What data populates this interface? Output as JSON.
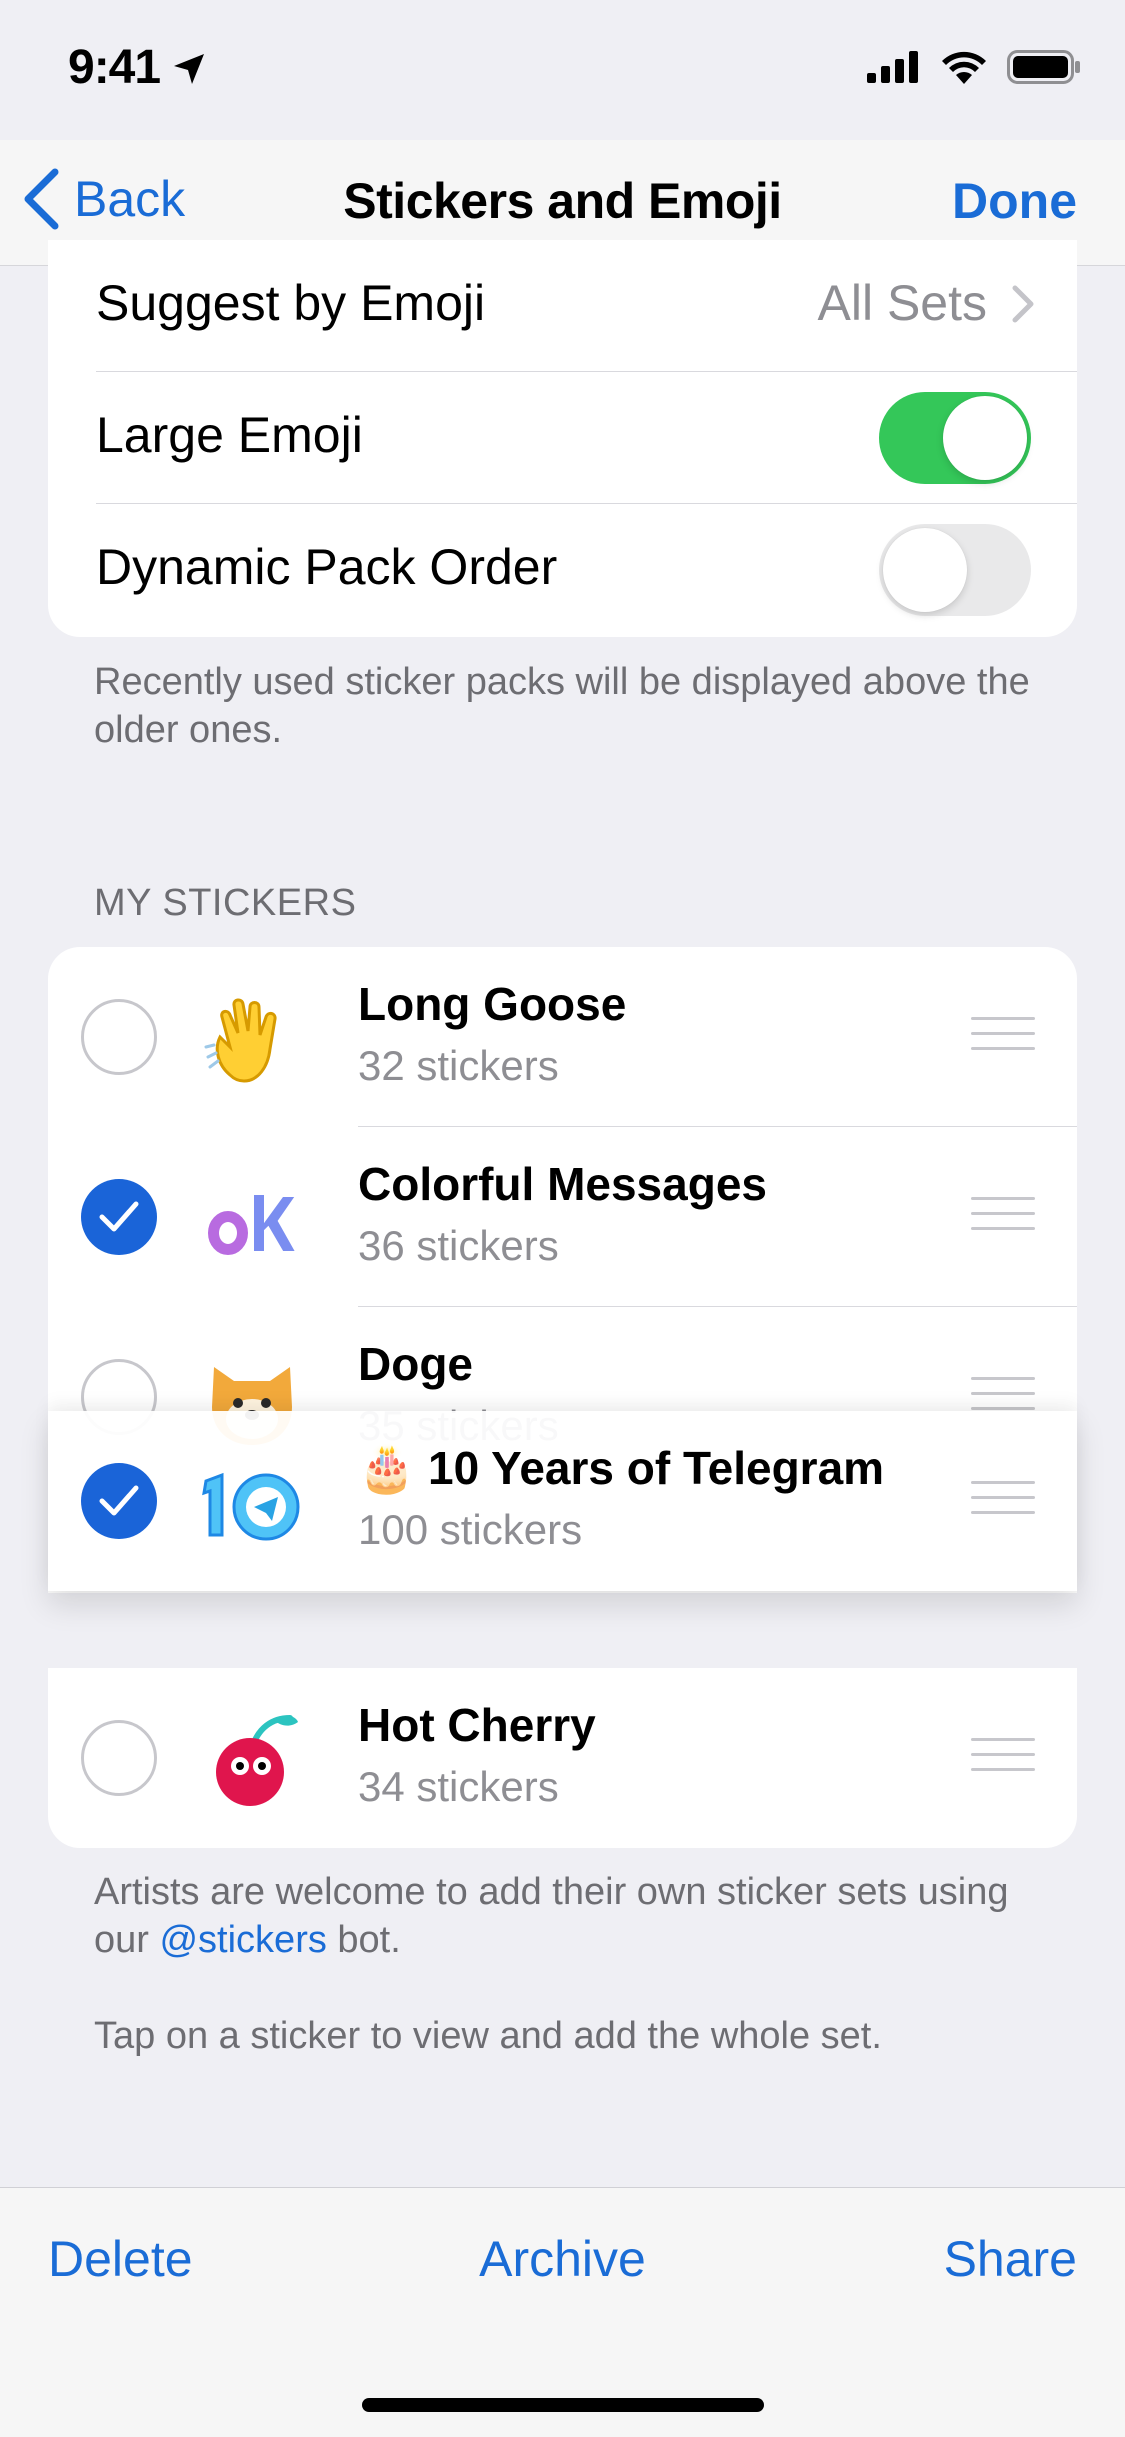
{
  "status_bar": {
    "time": "9:41"
  },
  "nav": {
    "back_label": "Back",
    "title": "Stickers and Emoji",
    "done_label": "Done"
  },
  "settings": {
    "suggest": {
      "label": "Suggest by Emoji",
      "value": "All Sets"
    },
    "large_emoji": {
      "label": "Large Emoji",
      "on": true
    },
    "dynamic_order": {
      "label": "Dynamic Pack Order",
      "on": false
    },
    "footnote": "Recently used sticker packs will be displayed above the older ones."
  },
  "my_stickers": {
    "header": "MY STICKERS",
    "items": [
      {
        "name": "Long Goose",
        "count": "32 stickers",
        "selected": false,
        "thumb": "waving-hand-icon"
      },
      {
        "name": "Colorful Messages",
        "count": "36 stickers",
        "selected": true,
        "thumb": "ok-text-icon"
      },
      {
        "name": "Doge",
        "count": "35 stickers",
        "selected": false,
        "thumb": "shiba-dog-icon"
      },
      {
        "name": "🎂 10 Years of Telegram",
        "count": "100 stickers",
        "selected": true,
        "thumb": "ten-telegram-icon",
        "dragging": true
      },
      {
        "name": "Hot Cherry",
        "count": "34 stickers",
        "selected": false,
        "thumb": "cherry-icon"
      }
    ]
  },
  "footer": {
    "artists_pre": "Artists are welcome to add their own sticker sets using our ",
    "artists_link": "@stickers",
    "artists_post": " bot.",
    "tap_hint": "Tap on a sticker to view and add the whole set."
  },
  "toolbar": {
    "delete_label": "Delete",
    "archive_label": "Archive",
    "share_label": "Share"
  },
  "colors": {
    "accent": "#1a6cd6",
    "toggle_on": "#34c759",
    "selected_radio": "#1a64d8"
  }
}
